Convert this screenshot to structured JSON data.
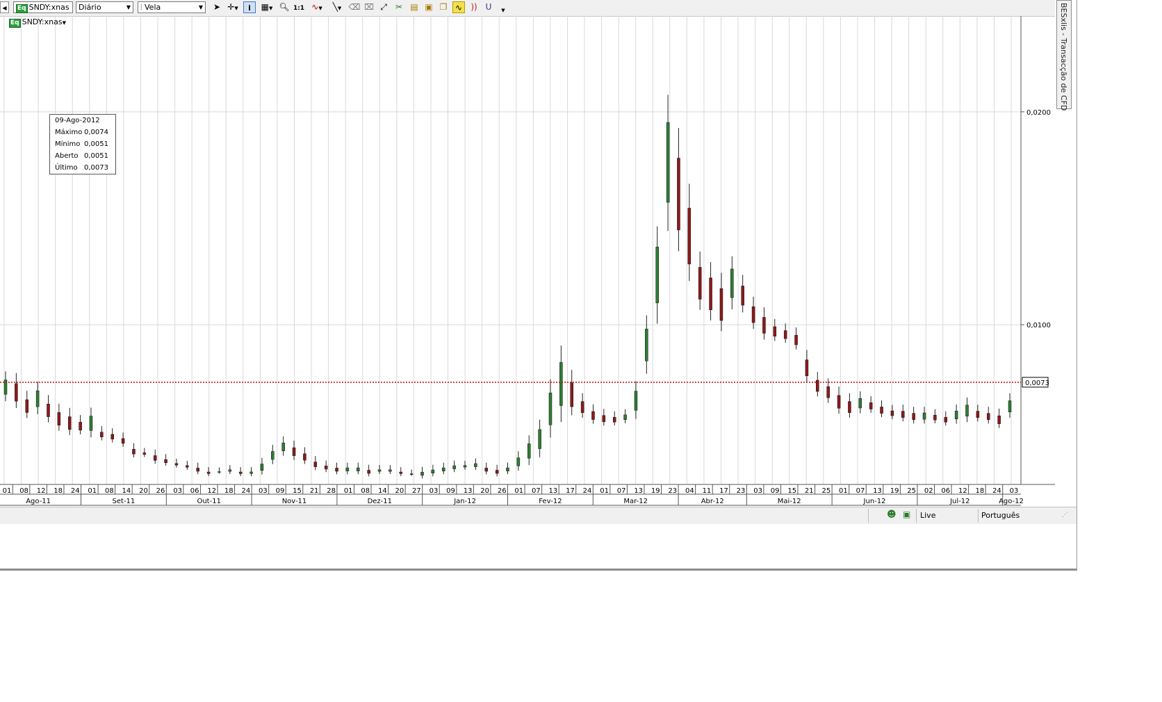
{
  "toolbar": {
    "symbol": "SNDY:xnas",
    "period": "Diário",
    "chart_type": "Vela",
    "equity_badge": "Eq"
  },
  "side_panel": {
    "title": "BESxlis - Transacção de CFD"
  },
  "chart_label": {
    "badge": "Eq",
    "text": "SNDY:xnas"
  },
  "tooltip": {
    "date": "09-Ago-2012",
    "rows": [
      {
        "label": "Máximo",
        "value": "0,0074"
      },
      {
        "label": "Mínimo",
        "value": "0,0051"
      },
      {
        "label": "Aberto",
        "value": "0,0051"
      },
      {
        "label": "Último",
        "value": "0,0073"
      }
    ]
  },
  "status": {
    "connection": "Live",
    "language": "Português"
  },
  "colors": {
    "up": "#2e7d32",
    "down": "#8b1a1a",
    "wick": "#222222",
    "last_line": "#cc0000",
    "grid": "#d9d9d9"
  },
  "chart_data": {
    "type": "candlestick",
    "y_ticks": [
      "0,0200",
      "0,0100"
    ],
    "last_price_label": "0,0073",
    "last_price": 0.0073,
    "ylim": [
      0.0025,
      0.0245
    ],
    "x_day_labels": [
      "01",
      "08",
      "12",
      "18",
      "24",
      "01",
      "08",
      "14",
      "20",
      "26",
      "03",
      "06",
      "12",
      "18",
      "24",
      "03",
      "09",
      "15",
      "21",
      "28",
      "01",
      "08",
      "14",
      "20",
      "27",
      "03",
      "09",
      "13",
      "20",
      "26",
      "01",
      "07",
      "13",
      "17",
      "24",
      "01",
      "07",
      "13",
      "19",
      "23",
      "04",
      "11",
      "17",
      "23",
      "03",
      "09",
      "15",
      "21",
      "25",
      "01",
      "07",
      "13",
      "19",
      "25",
      "02",
      "06",
      "12",
      "18",
      "24",
      "03"
    ],
    "x_month_labels": [
      "Ago-11",
      "Set-11",
      "Out-11",
      "Nov-11",
      "Dez-11",
      "Jan-12",
      "Fev-12",
      "Mar-12",
      "Abr-12",
      "Mai-12",
      "Jun-12",
      "Jul-12",
      "Ago-12"
    ],
    "series_points": [
      [
        0.0075,
        0.0066
      ],
      [
        0.0074,
        0.0063
      ],
      [
        0.0066,
        0.0058
      ],
      [
        0.007,
        0.006
      ],
      [
        0.0064,
        0.0056
      ],
      [
        0.006,
        0.0052
      ],
      [
        0.0058,
        0.005
      ],
      [
        0.0055,
        0.005
      ],
      [
        0.0058,
        0.0049
      ],
      [
        0.005,
        0.0047
      ],
      [
        0.0049,
        0.0046
      ],
      [
        0.0047,
        0.0044
      ],
      [
        0.0042,
        0.0039
      ],
      [
        0.004,
        0.0039
      ],
      [
        0.0039,
        0.0036
      ],
      [
        0.0037,
        0.0035
      ],
      [
        0.0035,
        0.0034
      ],
      [
        0.0034,
        0.0033
      ],
      [
        0.0033,
        0.0031
      ],
      [
        0.0031,
        0.003
      ],
      [
        0.0031,
        0.0031
      ],
      [
        0.0032,
        0.0031
      ],
      [
        0.0031,
        0.003
      ],
      [
        0.0031,
        0.003
      ],
      [
        0.0035,
        0.0031
      ],
      [
        0.0041,
        0.0036
      ],
      [
        0.0045,
        0.004
      ],
      [
        0.0043,
        0.0038
      ],
      [
        0.004,
        0.0036
      ],
      [
        0.0036,
        0.0033
      ],
      [
        0.0034,
        0.0032
      ],
      [
        0.0033,
        0.0031
      ],
      [
        0.0033,
        0.0031
      ],
      [
        0.0033,
        0.0031
      ],
      [
        0.0032,
        0.003
      ],
      [
        0.0032,
        0.0031
      ],
      [
        0.0032,
        0.0031
      ],
      [
        0.0031,
        0.003
      ],
      [
        0.003,
        0.003
      ],
      [
        0.0031,
        0.0029
      ],
      [
        0.0032,
        0.003
      ],
      [
        0.0033,
        0.0031
      ],
      [
        0.0034,
        0.0032
      ],
      [
        0.0034,
        0.0033
      ],
      [
        0.0035,
        0.0033
      ],
      [
        0.0033,
        0.0031
      ],
      [
        0.0032,
        0.003
      ],
      [
        0.0033,
        0.0031
      ],
      [
        0.0038,
        0.0033
      ],
      [
        0.0045,
        0.0036
      ],
      [
        0.0052,
        0.004
      ],
      [
        0.007,
        0.005
      ],
      [
        0.0085,
        0.0058
      ],
      [
        0.0075,
        0.006
      ],
      [
        0.0065,
        0.0058
      ],
      [
        0.006,
        0.0055
      ],
      [
        0.0058,
        0.0054
      ],
      [
        0.0057,
        0.0054
      ],
      [
        0.0058,
        0.0055
      ],
      [
        0.007,
        0.0058
      ],
      [
        0.01,
        0.008
      ],
      [
        0.014,
        0.0105
      ],
      [
        0.02,
        0.015
      ],
      [
        0.0185,
        0.014
      ],
      [
        0.016,
        0.0125
      ],
      [
        0.013,
        0.011
      ],
      [
        0.0125,
        0.0105
      ],
      [
        0.012,
        0.01
      ],
      [
        0.0128,
        0.011
      ],
      [
        0.012,
        0.0108
      ],
      [
        0.011,
        0.01
      ],
      [
        0.0105,
        0.0095
      ],
      [
        0.01,
        0.0094
      ],
      [
        0.0098,
        0.0093
      ],
      [
        0.0096,
        0.009
      ],
      [
        0.0085,
        0.0075
      ],
      [
        0.0075,
        0.0068
      ],
      [
        0.0072,
        0.0065
      ],
      [
        0.0068,
        0.006
      ],
      [
        0.0065,
        0.0058
      ],
      [
        0.0066,
        0.006
      ],
      [
        0.0064,
        0.006
      ],
      [
        0.0062,
        0.0058
      ],
      [
        0.006,
        0.0057
      ],
      [
        0.006,
        0.0056
      ],
      [
        0.0059,
        0.0055
      ],
      [
        0.0059,
        0.0055
      ],
      [
        0.0058,
        0.0055
      ],
      [
        0.0057,
        0.0054
      ],
      [
        0.006,
        0.0055
      ],
      [
        0.0063,
        0.0056
      ],
      [
        0.006,
        0.0056
      ],
      [
        0.0059,
        0.0055
      ],
      [
        0.0058,
        0.0053
      ],
      [
        0.0065,
        0.0058
      ]
    ]
  }
}
